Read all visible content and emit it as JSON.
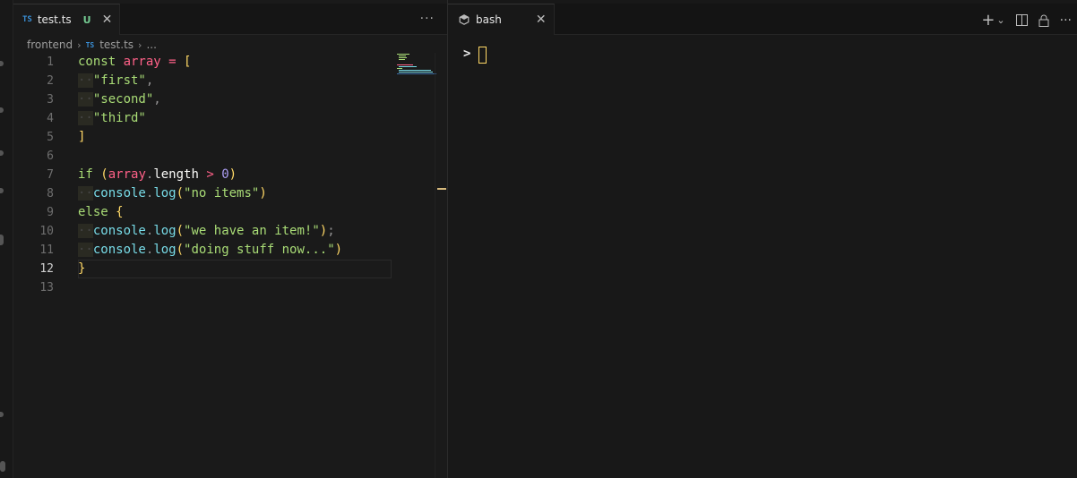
{
  "editor": {
    "tab": {
      "badge": "TS",
      "name": "test.ts",
      "status": "U",
      "close": "✕"
    },
    "more": "···",
    "breadcrumb": {
      "folder": "frontend",
      "badge": "TS",
      "file": "test.ts",
      "ellipsis": "..."
    },
    "lines": [
      {
        "n": "1",
        "tokens": [
          [
            "kw",
            "const "
          ],
          [
            "var",
            "array"
          ],
          [
            "op",
            " = "
          ],
          [
            "br",
            "["
          ]
        ]
      },
      {
        "n": "2",
        "tokens": [
          [
            "indent",
            "··"
          ],
          [
            "str",
            "\"first\""
          ],
          [
            "pun",
            ","
          ]
        ]
      },
      {
        "n": "3",
        "tokens": [
          [
            "indent",
            "··"
          ],
          [
            "str",
            "\"second\""
          ],
          [
            "pun",
            ","
          ]
        ]
      },
      {
        "n": "4",
        "tokens": [
          [
            "indent",
            "··"
          ],
          [
            "str",
            "\"third\""
          ]
        ]
      },
      {
        "n": "5",
        "tokens": [
          [
            "br",
            "]"
          ]
        ]
      },
      {
        "n": "6",
        "tokens": []
      },
      {
        "n": "7",
        "tokens": [
          [
            "kw",
            "if "
          ],
          [
            "br",
            "("
          ],
          [
            "var",
            "array"
          ],
          [
            "pun",
            "."
          ],
          [
            "pl",
            "length "
          ],
          [
            "op",
            ">"
          ],
          [
            "num",
            " 0"
          ],
          [
            "br",
            ")"
          ]
        ]
      },
      {
        "n": "8",
        "tokens": [
          [
            "indent",
            "··"
          ],
          [
            "fn",
            "console"
          ],
          [
            "pun",
            "."
          ],
          [
            "fn",
            "log"
          ],
          [
            "br",
            "("
          ],
          [
            "str",
            "\"no items\""
          ],
          [
            "br",
            ")"
          ]
        ]
      },
      {
        "n": "9",
        "tokens": [
          [
            "kw",
            "else "
          ],
          [
            "br",
            "{"
          ]
        ]
      },
      {
        "n": "10",
        "tokens": [
          [
            "indent",
            "··"
          ],
          [
            "fn",
            "console"
          ],
          [
            "pun",
            "."
          ],
          [
            "fn",
            "log"
          ],
          [
            "br",
            "("
          ],
          [
            "str",
            "\"we have an item!\""
          ],
          [
            "br",
            ")"
          ],
          [
            "pun",
            ";"
          ]
        ]
      },
      {
        "n": "11",
        "tokens": [
          [
            "indent",
            "··"
          ],
          [
            "fn",
            "console"
          ],
          [
            "pun",
            "."
          ],
          [
            "fn",
            "log"
          ],
          [
            "br",
            "("
          ],
          [
            "str",
            "\"doing stuff now...\""
          ],
          [
            "br",
            ")"
          ]
        ]
      },
      {
        "n": "12",
        "tokens": [
          [
            "br",
            "}"
          ]
        ]
      },
      {
        "n": "13",
        "tokens": []
      }
    ],
    "active_line": "12"
  },
  "terminal": {
    "tab": {
      "name": "bash",
      "close": "✕"
    },
    "actions": {
      "add": "+",
      "dropdown": "⌄",
      "split": "◫",
      "lock": "🔒",
      "more": "···"
    },
    "prompt": ">"
  },
  "colors": {
    "keyword": "#a9dc76",
    "variable": "#ff6188",
    "bracket": "#ffd866",
    "string": "#a9dc76",
    "function": "#78dce8",
    "number": "#ab9df2",
    "cursor": "#ffd866",
    "ts_badge": "#3a8fd6",
    "untracked": "#73c991"
  }
}
